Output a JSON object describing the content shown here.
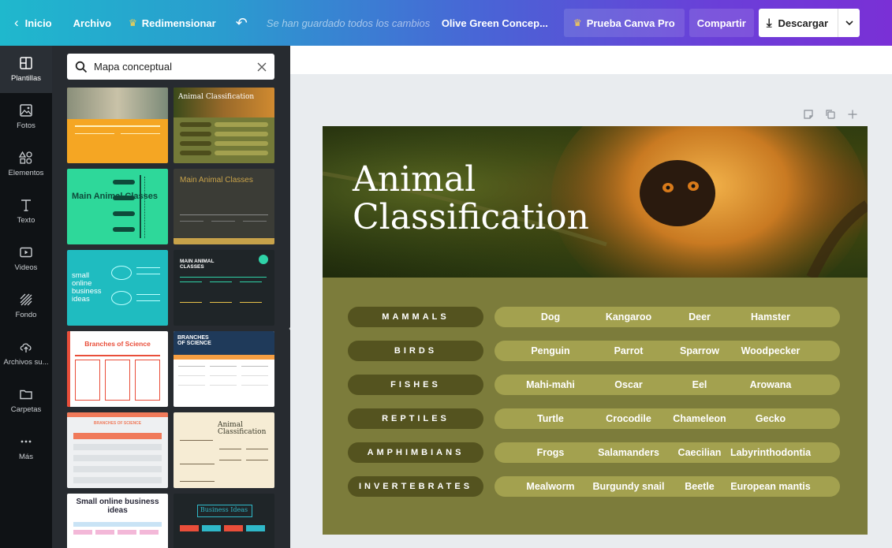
{
  "topbar": {
    "back": "Inicio",
    "file": "Archivo",
    "resize": "Redimensionar",
    "saved_status": "Se han guardado todos los cambios",
    "doc_title": "Olive Green Concep...",
    "try_pro": "Prueba Canva Pro",
    "share": "Compartir",
    "download": "Descargar"
  },
  "rail": [
    {
      "label": "Plantillas",
      "icon": "templates-icon"
    },
    {
      "label": "Fotos",
      "icon": "photos-icon"
    },
    {
      "label": "Elementos",
      "icon": "elements-icon"
    },
    {
      "label": "Texto",
      "icon": "text-icon"
    },
    {
      "label": "Videos",
      "icon": "video-icon"
    },
    {
      "label": "Fondo",
      "icon": "background-icon"
    },
    {
      "label": "Archivos su...",
      "icon": "upload-icon"
    },
    {
      "label": "Carpetas",
      "icon": "folder-icon"
    },
    {
      "label": "Más",
      "icon": "more-icon"
    }
  ],
  "panel": {
    "search_value": "Mapa conceptual",
    "templates": [
      {
        "title": "Animal Classification"
      },
      {
        "title": "Main Animal Classes"
      },
      {
        "title": "Main Animal Classes"
      },
      {
        "title": "small online business ideas"
      },
      {
        "title": "MAIN ANIMAL CLASSES"
      },
      {
        "title": "Branches of Science"
      },
      {
        "title": "BRANCHES OF SCIENCE"
      },
      {
        "title": "BRANCHES OF SCIENCE"
      },
      {
        "title": "Animal Classification"
      },
      {
        "title": "Small online business ideas"
      },
      {
        "title": "Business Ideas"
      }
    ]
  },
  "design": {
    "title_line1": "Animal",
    "title_line2": "Classification",
    "rows": [
      {
        "category": "MAMMALS",
        "items": [
          "Dog",
          "Kangaroo",
          "Deer",
          "Hamster"
        ]
      },
      {
        "category": "BIRDS",
        "items": [
          "Penguin",
          "Parrot",
          "Sparrow",
          "Woodpecker"
        ]
      },
      {
        "category": "FISHES",
        "items": [
          "Mahi-mahi",
          "Oscar",
          "Eel",
          "Arowana"
        ]
      },
      {
        "category": "REPTILES",
        "items": [
          "Turtle",
          "Crocodile",
          "Chameleon",
          "Gecko"
        ]
      },
      {
        "category": "AMPHIMBIANS",
        "items": [
          "Frogs",
          "Salamanders",
          "Caecilian",
          "Labyrinthodontia"
        ]
      },
      {
        "category": "INVERTEBRATES",
        "items": [
          "Mealworm",
          "Burgundy snail",
          "Beetle",
          "European mantis"
        ]
      }
    ]
  },
  "colors": {
    "design_bg": "#7c7c3b",
    "category_pill": "#54531f",
    "items_pill": "#a3a14f"
  }
}
